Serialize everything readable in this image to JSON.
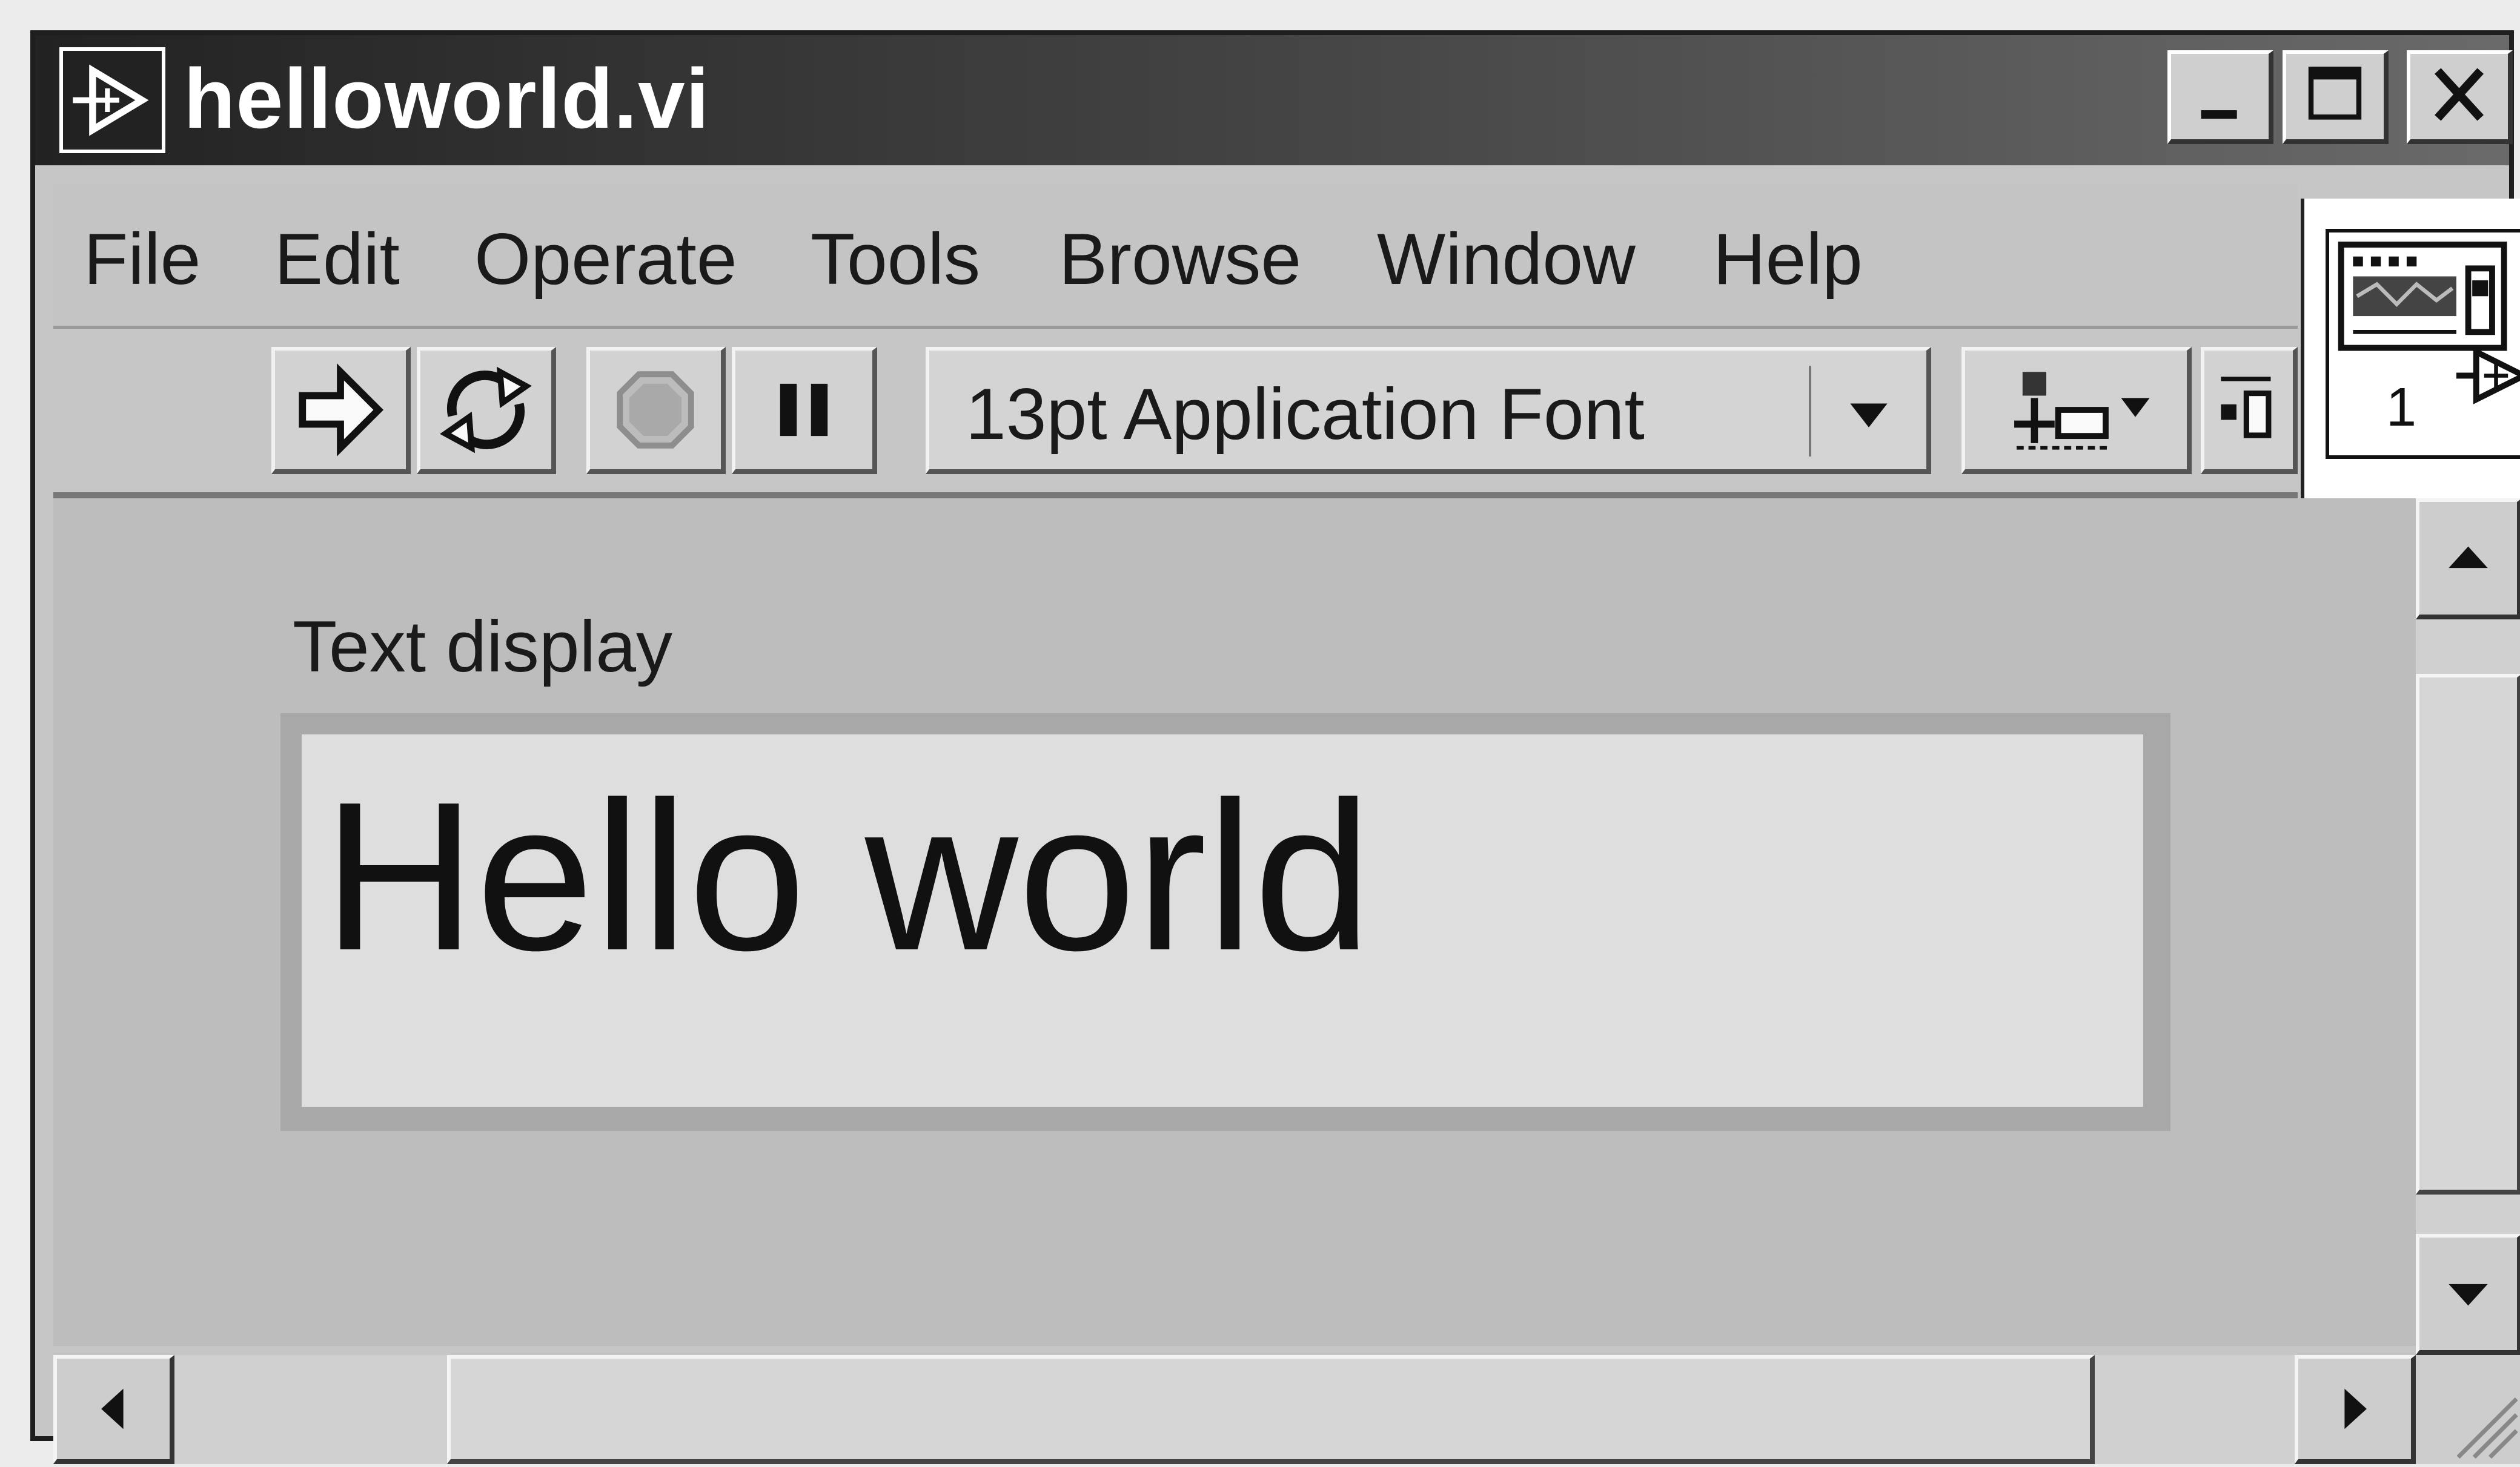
{
  "window": {
    "title": "helloworld.vi",
    "colors": {
      "titlebar": "#222222",
      "panel": "#bdbdbd",
      "indicator": "#dedede"
    }
  },
  "titlebar_buttons": {
    "minimize_icon": "minimize-icon",
    "maximize_icon": "maximize-icon",
    "close_icon": "close-icon"
  },
  "menu": {
    "items": [
      "File",
      "Edit",
      "Operate",
      "Tools",
      "Browse",
      "Window",
      "Help"
    ]
  },
  "toolbar": {
    "run_icon": "run-arrow-icon",
    "run_continuous_icon": "run-continuously-icon",
    "abort_icon": "abort-execution-icon",
    "pause_icon": "pause-icon",
    "font_ring_value": "13pt Application Font",
    "align_icon": "align-objects-icon",
    "distribute_icon": "distribute-objects-icon"
  },
  "connector": {
    "icon": "vi-connector-icon",
    "number": "1"
  },
  "front_panel": {
    "indicator_label": "Text display",
    "indicator_value": "Hello world"
  },
  "scrollbars": {
    "up_icon": "scroll-up-icon",
    "down_icon": "scroll-down-icon",
    "left_icon": "scroll-left-icon",
    "right_icon": "scroll-right-icon"
  }
}
